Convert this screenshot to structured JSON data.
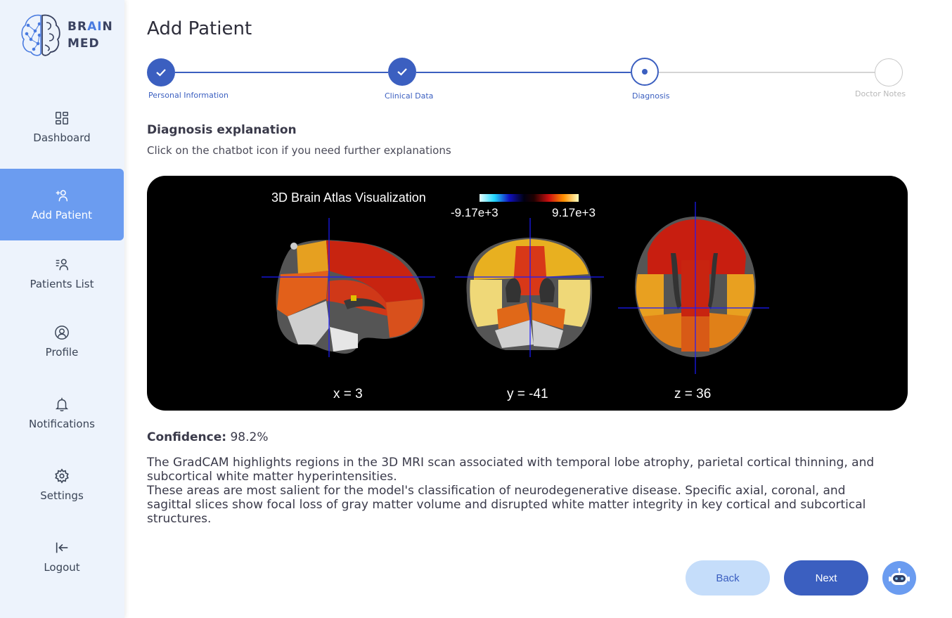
{
  "logo": {
    "line1_a": "BR",
    "line1_ai": "AI",
    "line1_b": "N",
    "line2": "MED"
  },
  "sidebar": {
    "items": [
      {
        "label": "Dashboard",
        "icon": "dashboard-icon"
      },
      {
        "label": "Add Patient",
        "icon": "add-user-icon",
        "active": true
      },
      {
        "label": "Patients List",
        "icon": "patients-list-icon"
      },
      {
        "label": "Profile",
        "icon": "profile-icon"
      },
      {
        "label": "Notifications",
        "icon": "bell-icon"
      },
      {
        "label": "Settings",
        "icon": "gear-icon"
      },
      {
        "label": "Logout",
        "icon": "logout-icon"
      }
    ]
  },
  "page": {
    "title": "Add Patient"
  },
  "stepper": {
    "steps": [
      {
        "label": "Personal Information",
        "status": "done"
      },
      {
        "label": "Clinical Data",
        "status": "done"
      },
      {
        "label": "Diagnosis",
        "status": "current"
      },
      {
        "label": "Doctor Notes",
        "status": "pending"
      }
    ]
  },
  "diagnosis": {
    "title": "Diagnosis explanation",
    "subtitle": "Click on the chatbot icon if you need further explanations"
  },
  "visualization": {
    "title": "3D Brain Atlas Visualization",
    "colorbar_min": "-9.17e+3",
    "colorbar_max": "9.17e+3",
    "slice_x": "x = 3",
    "slice_y": "y = -41",
    "slice_z": "z = 36"
  },
  "confidence": {
    "label": "Confidence:",
    "value": "98.2%"
  },
  "explanation": {
    "para1": "The GradCAM highlights regions in the 3D MRI scan associated with temporal lobe atrophy, parietal cortical thinning, and subcortical white matter hyperintensities.",
    "para2": "These areas are most salient for the model's classification of neurodegenerative disease. Specific axial, coronal, and sagittal slices show focal loss of gray matter volume and disrupted white matter integrity in key cortical and subcortical structures."
  },
  "buttons": {
    "back": "Back",
    "next": "Next"
  },
  "colors": {
    "accent": "#3b5fc0",
    "sidebar_active": "#6b9cf0",
    "sidebar_bg": "#edf3fc"
  }
}
